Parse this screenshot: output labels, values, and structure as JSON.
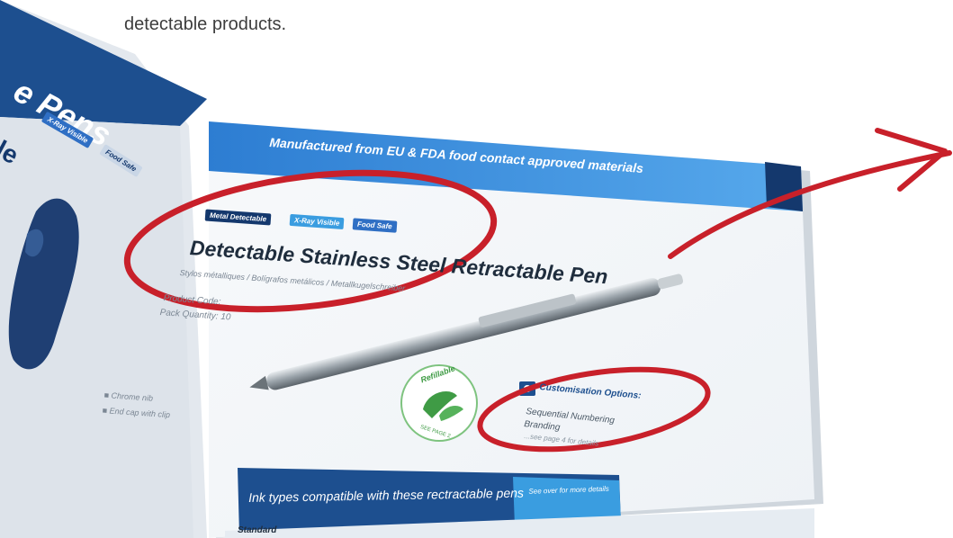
{
  "caption": "detectable products.",
  "left_page": {
    "title_fragment": "e Pens",
    "tags": [
      "X-Ray Visible",
      "Food Safe"
    ],
    "heading_fragment": "le"
  },
  "right_page": {
    "banner": "Manufactured from EU & FDA food contact approved materials",
    "tags": {
      "metal": "Metal Detectable",
      "xray": "X-Ray Visible",
      "food": "Food Safe"
    },
    "product_title": "Detectable Stainless Steel Retractable Pen",
    "subtitle": "Stylos métalliques / Bolígrafos metálicos / Metallkugelschreiber",
    "product_code": "Product Code:",
    "pack_quantity": "Pack Quantity: 10",
    "features": [
      "Chrome nib",
      "End cap with clip"
    ],
    "refillable": "Refillable",
    "refillable_sub": "SEE PAGE 2",
    "customisation": {
      "title": "Customisation Options:",
      "items": [
        "Sequential Numbering",
        "Branding"
      ],
      "more": "...see page 4 for details"
    },
    "ink_banner": "Ink types compatible with these rectractable pens",
    "see_over": "See over for more details",
    "ink_table": {
      "first_heading": "Standard"
    }
  },
  "colors": {
    "annotation_red": "#c8202a",
    "brand_dark": "#14386d",
    "brand_light": "#3a9de0"
  }
}
